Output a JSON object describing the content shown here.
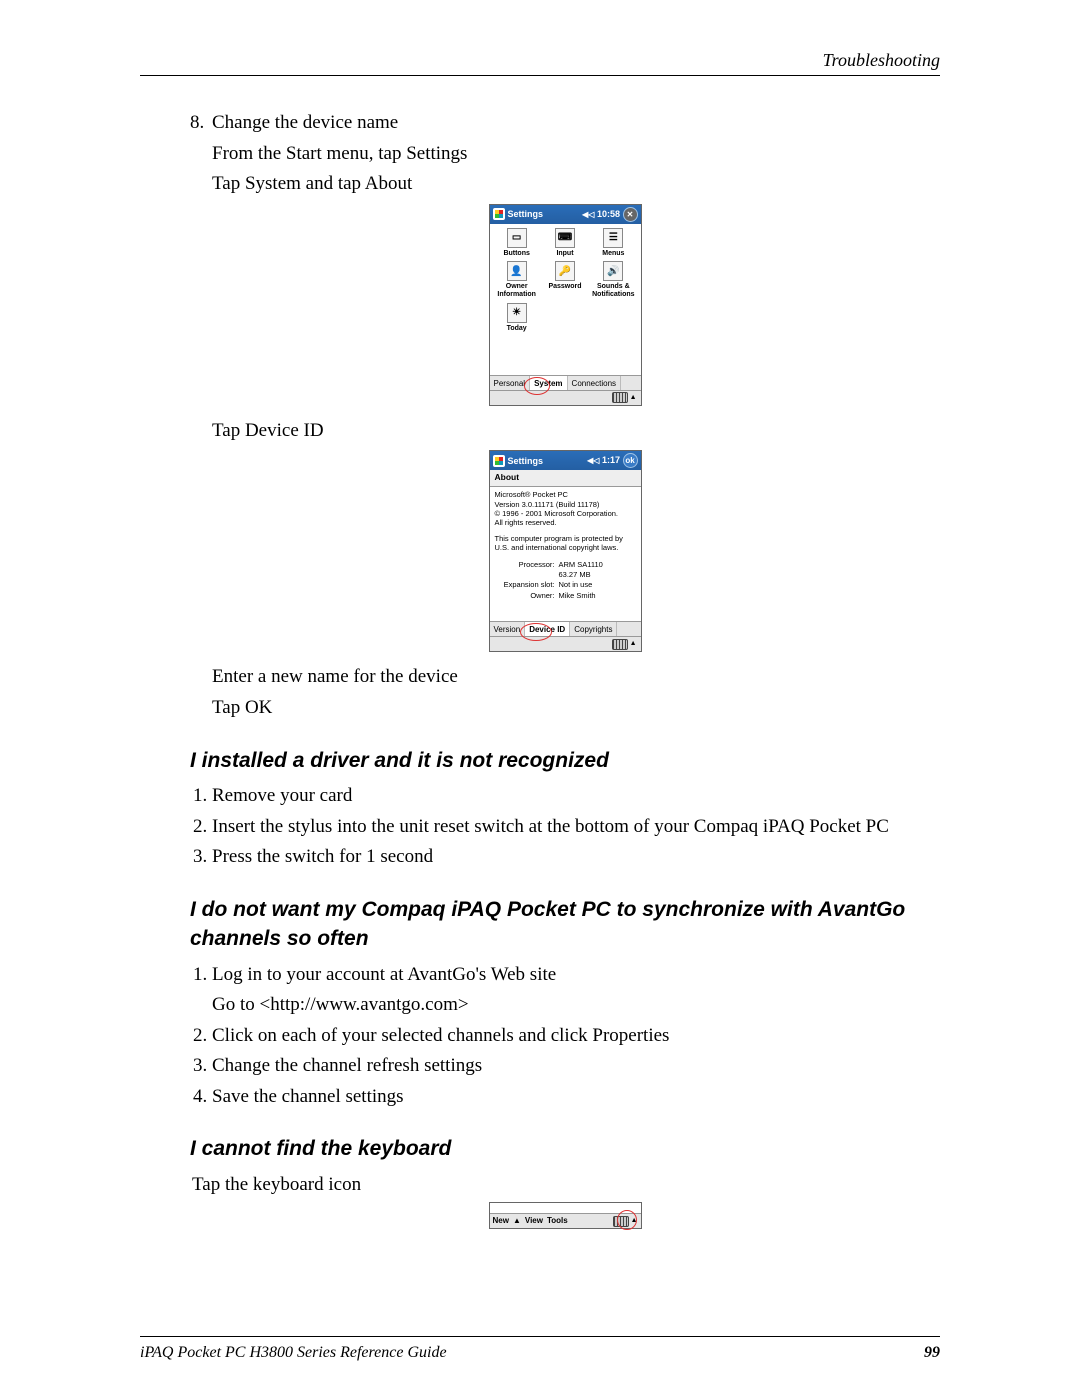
{
  "running_header": "Troubleshooting",
  "footer_left": "iPAQ Pocket PC H3800 Series Reference Guide",
  "footer_right": "99",
  "step8": {
    "num": "8.",
    "title": "Change the device name",
    "line2": "From the Start menu, tap Settings",
    "line3": "Tap System and tap About",
    "tap_device_id": "Tap Device ID",
    "enter_name": "Enter a new name for the device",
    "tap_ok": "Tap OK"
  },
  "section_driver": {
    "title": "I installed a driver and it is not recognized",
    "steps": [
      "Remove your card",
      "Insert the stylus into the unit reset switch at the bottom of your Compaq iPAQ Pocket PC",
      "Press the switch for 1 second"
    ]
  },
  "section_avantgo": {
    "title": "I do not want my Compaq iPAQ Pocket PC to synchronize with AvantGo channels so often",
    "step1": "Log in to your account at AvantGo's Web site",
    "step1_sub": "Go to <http://www.avantgo.com>",
    "steps_rest": [
      "Click on each of your selected channels and click Properties",
      "Change the channel refresh settings",
      "Save the channel settings"
    ]
  },
  "section_keyboard": {
    "title": "I cannot find the keyboard",
    "text": "Tap the keyboard icon"
  },
  "settings_screen": {
    "title": "Settings",
    "clock": "10:58",
    "icons": [
      "Buttons",
      "Input",
      "Menus",
      "Owner Information",
      "Password",
      "Sounds & Notifications",
      "Today"
    ],
    "tabs": [
      "Personal",
      "System",
      "Connections"
    ]
  },
  "about_screen": {
    "title": "Settings",
    "clock": "1:17",
    "ok": "ok",
    "about_label": "About",
    "body1": "Microsoft® Pocket PC",
    "body2": "Version 3.0.11171 (Build 11178)",
    "body3": "© 1996 - 2001 Microsoft Corporation.",
    "body4": "All rights reserved.",
    "body5": "This computer program is protected by U.S. and international copyright laws.",
    "proc_k": "Processor:",
    "proc_v": "ARM SA1110",
    "mem_v": "63.27 MB",
    "slot_k": "Expansion slot:",
    "slot_v": "Not in use",
    "owner_k": "Owner:",
    "owner_v": "Mike Smith",
    "tabs": [
      "Version",
      "Device ID",
      "Copyrights"
    ]
  },
  "notes_bar": {
    "new": "New",
    "view": "View",
    "tools": "Tools"
  }
}
